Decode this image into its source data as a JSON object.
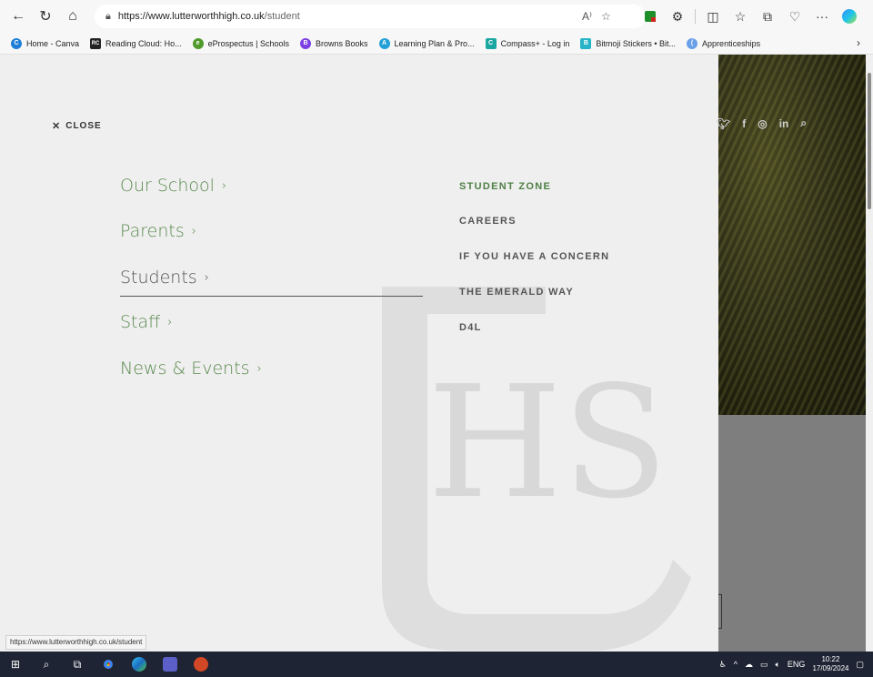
{
  "browser": {
    "url_host": "https://www.lutterworthhigh.co.uk",
    "url_path": "/student",
    "bookmarks": [
      {
        "label": "Home - Canva",
        "color": "#1f7fd6",
        "glyph": "C"
      },
      {
        "label": "Reading Cloud: Ho...",
        "color": "#222222",
        "glyph": "RC"
      },
      {
        "label": "eProspectus | Schools",
        "color": "#4f9a2b",
        "glyph": "e"
      },
      {
        "label": "Browns Books",
        "color": "#7b3fe4",
        "glyph": "B"
      },
      {
        "label": "Learning Plan & Pro...",
        "color": "#23a0d8",
        "glyph": "A"
      },
      {
        "label": "Compass+ - Log in",
        "color": "#1aa7a1",
        "glyph": "C"
      },
      {
        "label": "Bitmoji Stickers • Bit...",
        "color": "#28b4c8",
        "glyph": "B"
      },
      {
        "label": "Apprenticeships",
        "color": "#6aa0e8",
        "glyph": "("
      }
    ]
  },
  "menu": {
    "close_label": "CLOSE",
    "main_nav": [
      {
        "label": "Our School",
        "chevron": "›"
      },
      {
        "label": "Parents",
        "chevron": "›"
      },
      {
        "label": "Students",
        "chevron": "›"
      },
      {
        "label": "Staff",
        "chevron": "›"
      },
      {
        "label": "News & Events",
        "chevron": "›"
      }
    ],
    "sub_nav": [
      {
        "label": "STUDENT ZONE",
        "active": true
      },
      {
        "label": "CAREERS",
        "active": false
      },
      {
        "label": "IF YOU HAVE A CONCERN",
        "active": false
      },
      {
        "label": "THE EMERALD WAY",
        "active": false
      },
      {
        "label": "D4L",
        "active": false
      }
    ],
    "social_icons": [
      "twitter-icon",
      "facebook-icon",
      "instagram-icon",
      "linkedin-icon",
      "search-icon"
    ],
    "accent_green": "#5a8a4e"
  },
  "status_bar": {
    "link_preview": "https://www.lutterworthhigh.co.uk/student"
  },
  "taskbar": {
    "language": "ENG",
    "time": "10:22",
    "date": "17/09/2024"
  }
}
